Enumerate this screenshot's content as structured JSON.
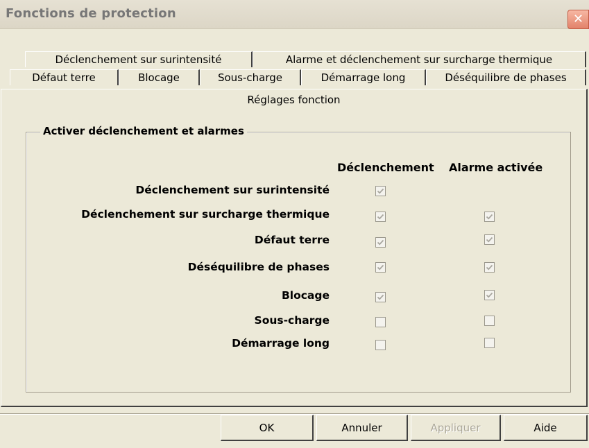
{
  "window": {
    "title": "Fonctions de protection",
    "close_icon": "close-icon"
  },
  "tabs": {
    "row1": [
      "Déclenchement sur surintensité",
      "Alarme et déclenchement sur surcharge thermique"
    ],
    "row2": [
      "Défaut terre",
      "Blocage",
      "Sous-charge",
      "Démarrage long",
      "Déséquilibre de phases"
    ]
  },
  "panel": {
    "title": "Réglages fonction",
    "group_title": "Activer déclenchement et alarmes",
    "col_trip": "Déclenchement",
    "col_alarm": "Alarme activée",
    "rows": [
      {
        "label": "Déclenchement sur surintensité",
        "trip": true,
        "alarm": null
      },
      {
        "label": "Déclenchement sur surcharge thermique",
        "trip": true,
        "alarm": true
      },
      {
        "label": "Défaut terre",
        "trip": true,
        "alarm": true
      },
      {
        "label": "Déséquilibre de phases",
        "trip": true,
        "alarm": true
      },
      {
        "label": "Blocage",
        "trip": true,
        "alarm": true
      },
      {
        "label": "Sous-charge",
        "trip": false,
        "alarm": false
      },
      {
        "label": "Démarrage long",
        "trip": false,
        "alarm": false
      }
    ]
  },
  "buttons": {
    "ok": "OK",
    "cancel": "Annuler",
    "apply": "Appliquer",
    "help": "Aide"
  },
  "colors": {
    "dialog_bg": "#ece9d8",
    "title_text": "#777777",
    "close_button": "#e2826a",
    "disabled_text": "#aca899"
  }
}
